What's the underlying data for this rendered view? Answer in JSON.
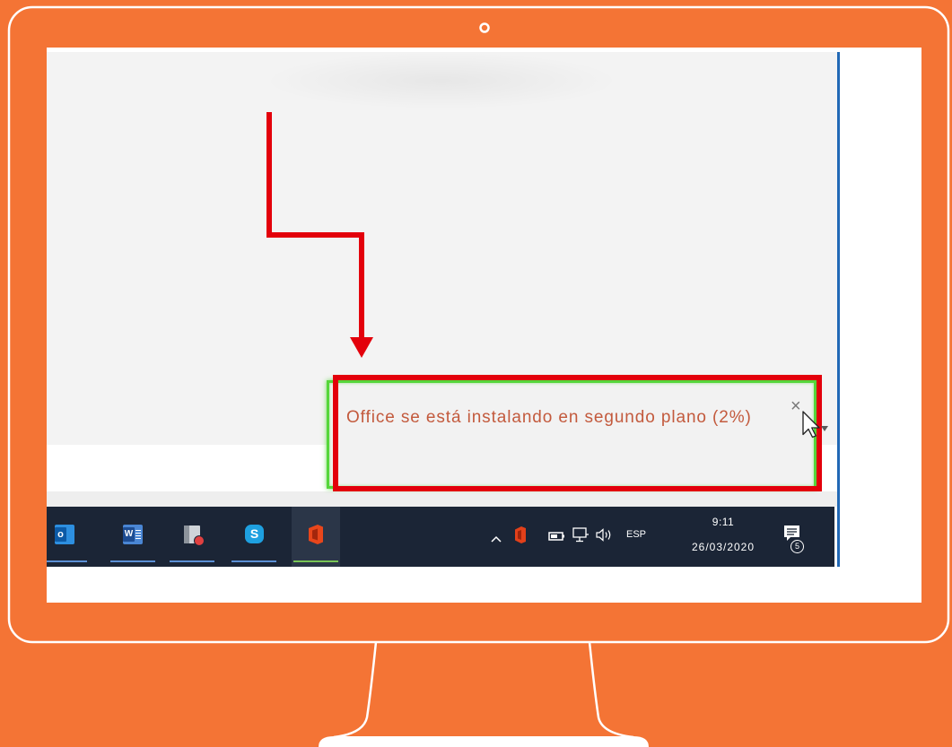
{
  "colors": {
    "background": "#F47435",
    "frame": "#FFFFFF",
    "highlight": "#E3000B",
    "toast_border": "#55D63A",
    "toast_text": "#C35A3D",
    "taskbar": "#1B2536",
    "window_border": "#2168B5"
  },
  "monitor": {
    "camera_icon": "camera-icon"
  },
  "callout": {
    "arrow_icon": "arrow-down-icon"
  },
  "toast": {
    "message": "Office se está instalando en segundo plano (2%)",
    "close_icon": "close-icon",
    "close_glyph": "×",
    "menu_icon": "caret-down-icon"
  },
  "cursor_icon": "mouse-cursor-icon",
  "taskbar": {
    "apps": [
      {
        "icon": "outlook-icon",
        "glyph": "o",
        "running": true,
        "active": false
      },
      {
        "icon": "word-icon",
        "glyph": "W",
        "running": true,
        "active": false
      },
      {
        "icon": "app-document-icon",
        "running": true,
        "active": false
      },
      {
        "icon": "skype-icon",
        "glyph": "S",
        "running": true,
        "active": false
      },
      {
        "icon": "office-icon",
        "running": true,
        "active": true
      }
    ],
    "tray": {
      "overflow_icon": "chevron-up-icon",
      "icons": [
        "office-tray-icon",
        "battery-icon",
        "network-icon",
        "volume-icon"
      ],
      "language": "ESP",
      "time": "9:11",
      "date": "26/03/2020",
      "notifications_icon": "action-center-icon",
      "notifications_count": "5"
    }
  }
}
